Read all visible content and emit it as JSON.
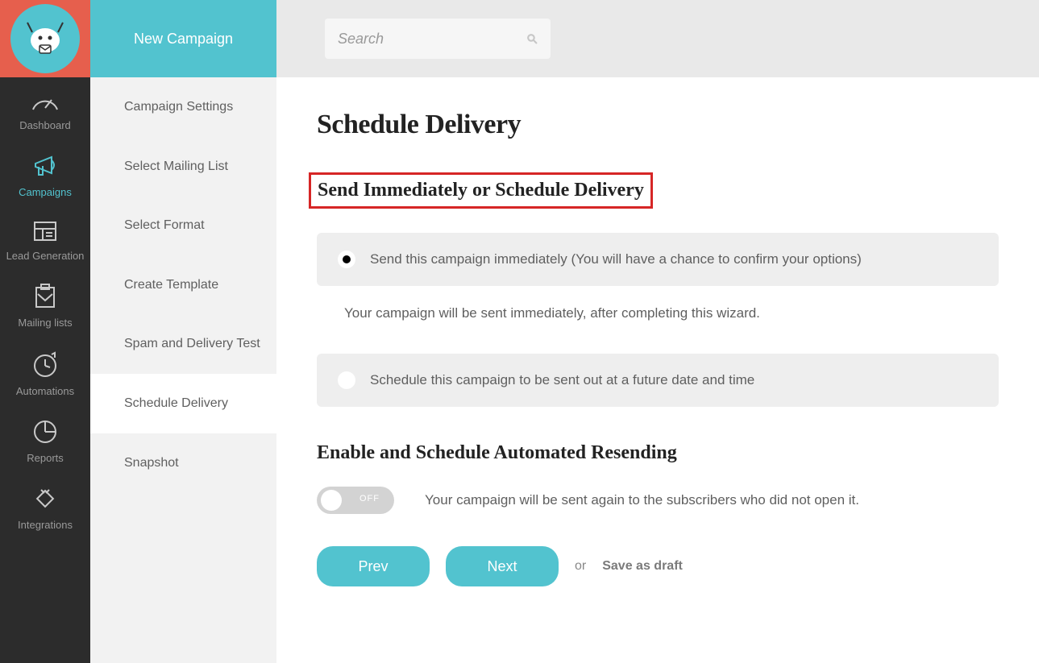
{
  "iconNav": {
    "items": [
      {
        "label": "Dashboard"
      },
      {
        "label": "Campaigns"
      },
      {
        "label": "Lead Generation"
      },
      {
        "label": "Mailing lists"
      },
      {
        "label": "Automations"
      },
      {
        "label": "Reports"
      },
      {
        "label": "Integrations"
      }
    ]
  },
  "stepsHeader": "New Campaign",
  "steps": [
    "Campaign Settings",
    "Select Mailing List",
    "Select Format",
    "Create Template",
    "Spam and Delivery Test",
    "Schedule Delivery",
    "Snapshot"
  ],
  "search": {
    "placeholder": "Search"
  },
  "page": {
    "title": "Schedule Delivery",
    "sendSection": {
      "title": "Send Immediately or Schedule Delivery",
      "option1": "Send this campaign immediately (You will have a chance to confirm your options)",
      "option1Help": "Your campaign will be sent immediately, after completing this wizard.",
      "option2": "Schedule this campaign to be sent out at a future date and time"
    },
    "resendSection": {
      "title": "Enable and Schedule Automated Resending",
      "toggleLabel": "OFF",
      "description": "Your campaign will be sent again to the subscribers who did not open it."
    },
    "footer": {
      "prev": "Prev",
      "next": "Next",
      "or": "or",
      "draft": "Save as draft"
    }
  }
}
